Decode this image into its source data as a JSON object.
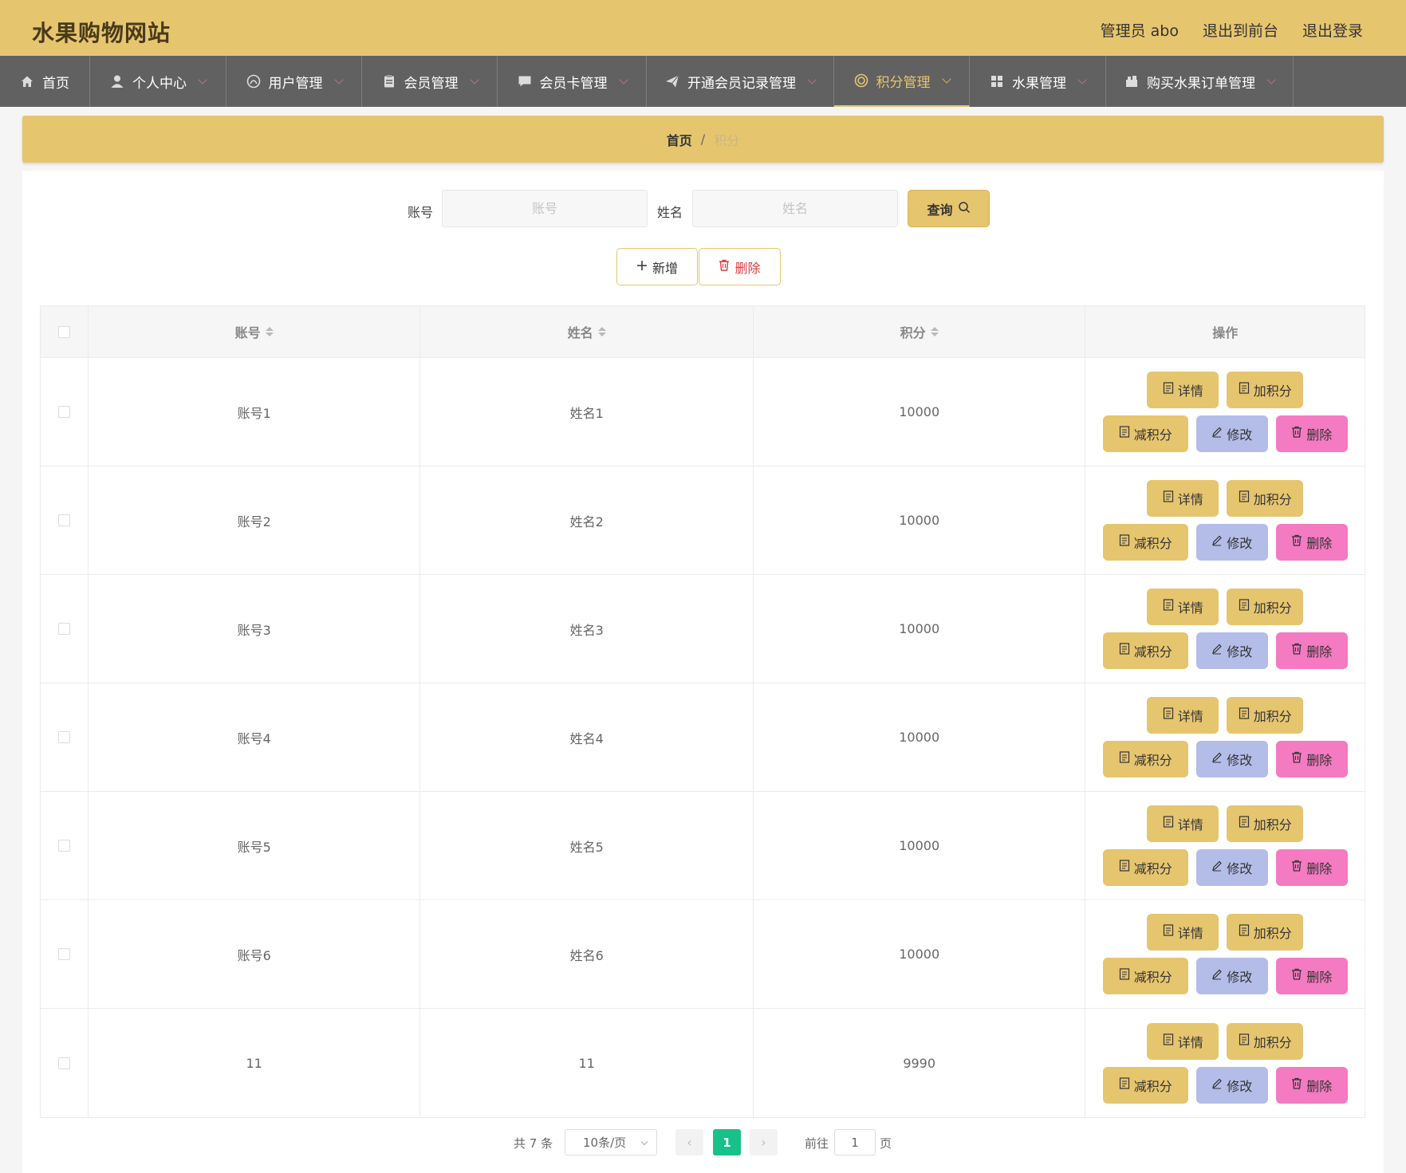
{
  "header": {
    "site_title": "水果购物网站",
    "admin": "管理员 abo",
    "to_front": "退出到前台",
    "logout": "退出登录"
  },
  "nav": [
    {
      "label": "首页",
      "icon": "home-icon",
      "has_caret": false,
      "active": false
    },
    {
      "label": "个人中心",
      "icon": "user-icon",
      "has_caret": true,
      "active": false
    },
    {
      "label": "用户管理",
      "icon": "users-circle-icon",
      "has_caret": true,
      "active": false
    },
    {
      "label": "会员管理",
      "icon": "clipboard-icon",
      "has_caret": true,
      "active": false
    },
    {
      "label": "会员卡管理",
      "icon": "chat-icon",
      "has_caret": true,
      "active": false
    },
    {
      "label": "开通会员记录管理",
      "icon": "send-icon",
      "has_caret": true,
      "active": false
    },
    {
      "label": "积分管理",
      "icon": "ring-icon",
      "has_caret": true,
      "active": true
    },
    {
      "label": "水果管理",
      "icon": "grid-icon",
      "has_caret": true,
      "active": false
    },
    {
      "label": "购买水果订单管理",
      "icon": "cart-icon",
      "has_caret": true,
      "active": false
    }
  ],
  "breadcrumb": {
    "home": "首页",
    "sep": "/",
    "current": "积分"
  },
  "search": {
    "account_label": "账号",
    "account_placeholder": "账号",
    "name_label": "姓名",
    "name_placeholder": "姓名",
    "query_label": "查询"
  },
  "actions": {
    "add": "新增",
    "delete": "删除"
  },
  "table": {
    "headers": {
      "account": "账号",
      "name": "姓名",
      "points": "积分",
      "ops": "操作"
    },
    "rows": [
      {
        "account": "账号1",
        "name": "姓名1",
        "points": "10000"
      },
      {
        "account": "账号2",
        "name": "姓名2",
        "points": "10000"
      },
      {
        "account": "账号3",
        "name": "姓名3",
        "points": "10000"
      },
      {
        "account": "账号4",
        "name": "姓名4",
        "points": "10000"
      },
      {
        "account": "账号5",
        "name": "姓名5",
        "points": "10000"
      },
      {
        "account": "账号6",
        "name": "姓名6",
        "points": "10000"
      },
      {
        "account": "11",
        "name": "11",
        "points": "9990"
      }
    ],
    "ops": {
      "detail": "详情",
      "add_points": "加积分",
      "sub_points": "减积分",
      "edit": "修改",
      "remove": "删除"
    }
  },
  "pagination": {
    "total": "共 7 条",
    "page_size": "10条/页",
    "current_page": "1",
    "goto_label": "前往",
    "goto_value": "1",
    "page_suffix": "页"
  },
  "colors": {
    "header_bg": "#e6c56f",
    "nav_bg": "#616161",
    "edit_button": "#b4bde8",
    "delete_button": "#f47ac1",
    "pager_active": "#18c08a"
  }
}
